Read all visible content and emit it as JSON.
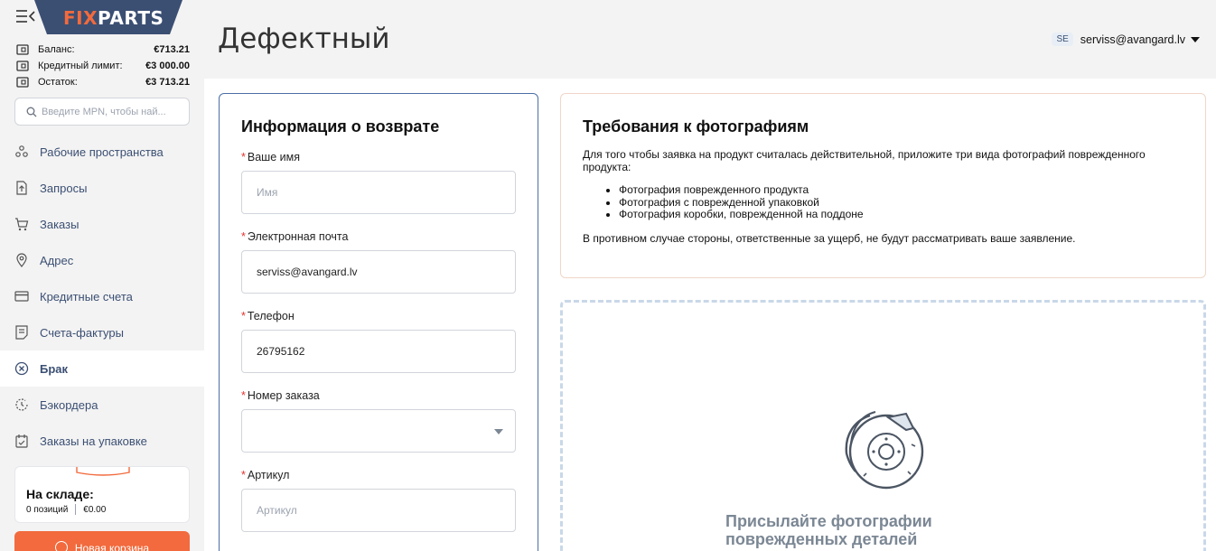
{
  "brand": {
    "logo_fix": "FIX",
    "logo_parts": "PARTS"
  },
  "balance": {
    "rows": [
      {
        "label": "Баланс:",
        "value": "€713.21"
      },
      {
        "label": "Кредитный лимит:",
        "value": "€3 000.00"
      },
      {
        "label": "Остаток:",
        "value": "€3 713.21"
      }
    ]
  },
  "search": {
    "placeholder": "Введите MPN, чтобы най..."
  },
  "nav": [
    {
      "label": "Рабочие пространства",
      "icon": "workspaces-icon"
    },
    {
      "label": "Запросы",
      "icon": "requests-icon"
    },
    {
      "label": "Заказы",
      "icon": "cart-icon"
    },
    {
      "label": "Адрес",
      "icon": "location-pin-icon"
    },
    {
      "label": "Кредитные счета",
      "icon": "credit-card-icon"
    },
    {
      "label": "Счета-фактуры",
      "icon": "invoice-icon"
    },
    {
      "label": "Брак",
      "icon": "defect-circle-x-icon",
      "active": true
    },
    {
      "label": "Бэкордера",
      "icon": "backorder-icon"
    },
    {
      "label": "Заказы на упаковке",
      "icon": "packaging-icon"
    }
  ],
  "stock": {
    "title": "На складе:",
    "count": "0 позиций",
    "amount": "€0.00"
  },
  "new_cart": {
    "label": "Новая корзина"
  },
  "header": {
    "title": "Дефектный",
    "lang": "SE",
    "user_email": "serviss@avangard.lv"
  },
  "form": {
    "title": "Информация о возврате",
    "fields": {
      "name": {
        "label": "Ваше имя",
        "placeholder": "Имя",
        "value": ""
      },
      "email": {
        "label": "Электронная почта",
        "value": "serviss@avangard.lv"
      },
      "phone": {
        "label": "Телефон",
        "value": "26795162"
      },
      "order": {
        "label": "Номер заказа",
        "value": ""
      },
      "article": {
        "label": "Артикул",
        "placeholder": "Артикул",
        "value": ""
      }
    }
  },
  "requirements": {
    "title": "Требования к фотографиям",
    "intro": "Для того чтобы заявка на продукт считалась действительной, приложите три вида фотографий поврежденного продукта:",
    "items": [
      "Фотография поврежденного продукта",
      "Фотография с поврежденной упаковкой",
      "Фотография коробки, поврежденной на поддоне"
    ],
    "note": "В противном случае стороны, ответственные за ущерб, не будут рассматривать ваше заявление."
  },
  "upload": {
    "text": "Присылайте фотографии поврежденных деталей сюда",
    "icon": "brake-disc-icon"
  },
  "colors": {
    "accent": "#f26a3d",
    "navy": "#3b4f73",
    "form_border": "#4a6fa5"
  }
}
